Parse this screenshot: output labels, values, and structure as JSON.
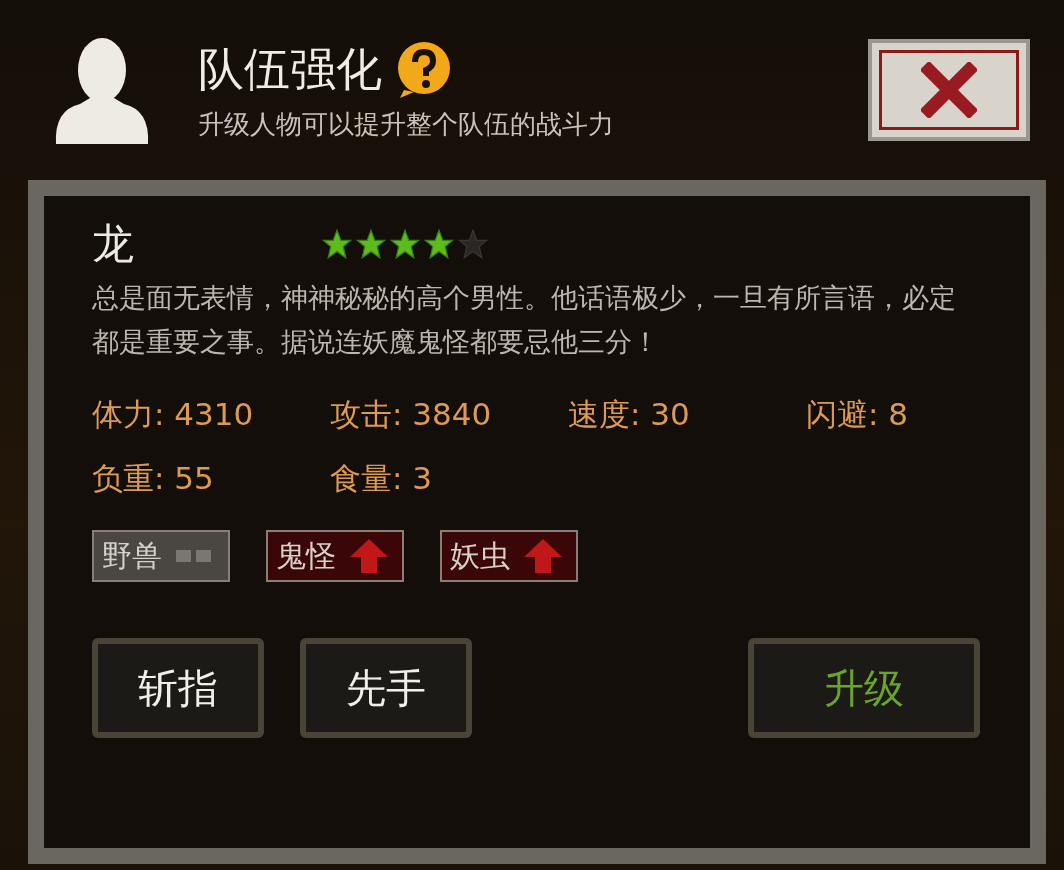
{
  "header": {
    "title": "队伍强化",
    "subtitle": "升级人物可以提升整个队伍的战斗力"
  },
  "character": {
    "name": "龙",
    "stars": 4,
    "description": "总是面无表情，神神秘秘的高个男性。他话语极少，一旦有所言语，必定都是重要之事。据说连妖魔鬼怪都要忌他三分！"
  },
  "stats": [
    "体力: 4310",
    "攻击: 3840",
    "速度: 30",
    "闪避: 8",
    "负重: 55",
    "食量: 3"
  ],
  "tags": [
    {
      "label": "野兽",
      "kind": "neutral"
    },
    {
      "label": "鬼怪",
      "kind": "up"
    },
    {
      "label": "妖虫",
      "kind": "up"
    }
  ],
  "skills": [
    "斩指",
    "先手"
  ],
  "upgrade_button": "升级"
}
